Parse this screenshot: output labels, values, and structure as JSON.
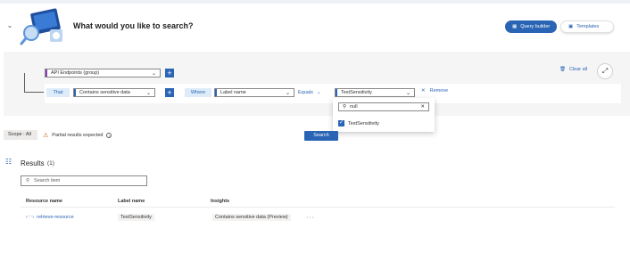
{
  "header": {
    "title": "What would you like to search?",
    "query_builder_label": "Query builder",
    "templates_label": "Templates"
  },
  "builder": {
    "group_select": "API Endpoints (group)",
    "that_label": "That",
    "condition_select": "Contains sensitive data",
    "where_label": "Where",
    "field_select": "Label name",
    "operator_label": "Equals",
    "value_select": "TestSensitivity",
    "remove_label": "Remove",
    "clear_all_label": "Clear all"
  },
  "value_popup": {
    "search_value": "null",
    "options": [
      {
        "label": "TestSensitivity",
        "checked": true
      }
    ]
  },
  "status": {
    "scope": "Scope : All",
    "partial": "Partial results expected",
    "search_button": "Search"
  },
  "results": {
    "title": "Results",
    "count": "(1)",
    "search_placeholder": "Search item",
    "columns": [
      "Resource name",
      "Label name",
      "Insights"
    ],
    "rows": [
      {
        "resource": "retrieve-resource",
        "label": "TestSensitivity",
        "insight": "Contains sensitive data (Preview)"
      }
    ]
  },
  "colors": {
    "accent": "#2a64b4",
    "warning": "#c45a00"
  },
  "icons": [
    "chevron-down-icon",
    "search-hero-icon",
    "query-builder-icon",
    "templates-icon",
    "plus-icon",
    "close-icon",
    "trash-icon",
    "expand-icon",
    "search-icon",
    "check-icon",
    "warning-icon",
    "info-icon",
    "results-icon",
    "api-icon",
    "more-icon"
  ]
}
